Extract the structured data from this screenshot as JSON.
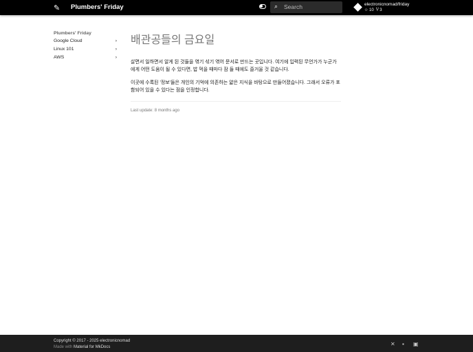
{
  "header": {
    "title": "Plumbers' Friday",
    "search_placeholder": "Search",
    "repo": {
      "name": "electronicnomad/friday",
      "stars": "☆ 10",
      "forks": "Ⴤ 3"
    }
  },
  "nav": {
    "title": "Plumbers' Friday",
    "items": [
      {
        "label": "Google Cloud"
      },
      {
        "label": "Linux 101"
      },
      {
        "label": "AWS"
      }
    ]
  },
  "content": {
    "title": "배관공들의 금요일",
    "paragraphs": [
      "살면서 일하면서 알게 된 것들을 엮기 섞기 엮어 문서로 만드는 곳입니다. 여기에 입력된 무언가가 누군가에게 어떤 도움이 될 수 있다면, 밥 먹을 때마다 잠 들 때에도 즐거울 것 같습니다.",
      "이곳에 수록된 '정보'들은 개인의 기억에 의존하는 얇은 지식을 바탕으로 만들어졌습니다. 그래서 오류가 포함되어 있을 수 있다는 점을 인정합니다."
    ],
    "last_update": "Last update: 8 months ago"
  },
  "footer": {
    "copyright": "Copyright © 2017 - 2025 electronicnomad",
    "made_with": "Made with",
    "material": "Material for MkDocs"
  }
}
